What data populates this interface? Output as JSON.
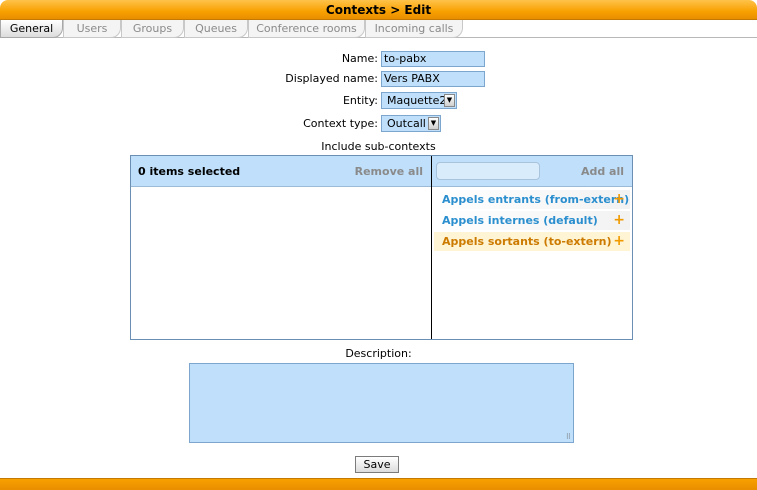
{
  "header": {
    "title": "Contexts > Edit"
  },
  "tabs": [
    {
      "label": "General",
      "active": true
    },
    {
      "label": "Users"
    },
    {
      "label": "Groups"
    },
    {
      "label": "Queues"
    },
    {
      "label": "Conference rooms"
    },
    {
      "label": "Incoming calls"
    }
  ],
  "form": {
    "name_label": "Name:",
    "name_value": "to-pabx",
    "displayed_label": "Displayed name:",
    "displayed_value": "Vers PABX",
    "entity_label": "Entity:",
    "entity_value": "Maquette2",
    "context_type_label": "Context type:",
    "context_type_value": "Outcall"
  },
  "subcontexts": {
    "title": "Include sub-contexts",
    "selected_count": "0 items selected",
    "remove_all": "Remove all",
    "add_all": "Add all",
    "search_placeholder": "",
    "available": [
      {
        "label": "Appels entrants (from-extern)",
        "highlighted": false
      },
      {
        "label": "Appels internes (default)",
        "highlighted": false
      },
      {
        "label": "Appels sortants (to-extern)",
        "highlighted": true
      }
    ],
    "add_symbol": "+"
  },
  "description": {
    "label": "Description:",
    "value": ""
  },
  "actions": {
    "save_label": "Save"
  },
  "icons": {
    "dropdown": "dropdown-arrow-icon",
    "add": "plus-icon",
    "resize": "resize-grip-icon"
  },
  "colors": {
    "accent": "#f8a000",
    "field_bg": "#bfdffb",
    "link": "#2b8fcf",
    "highlight_text": "#cc7a00"
  }
}
